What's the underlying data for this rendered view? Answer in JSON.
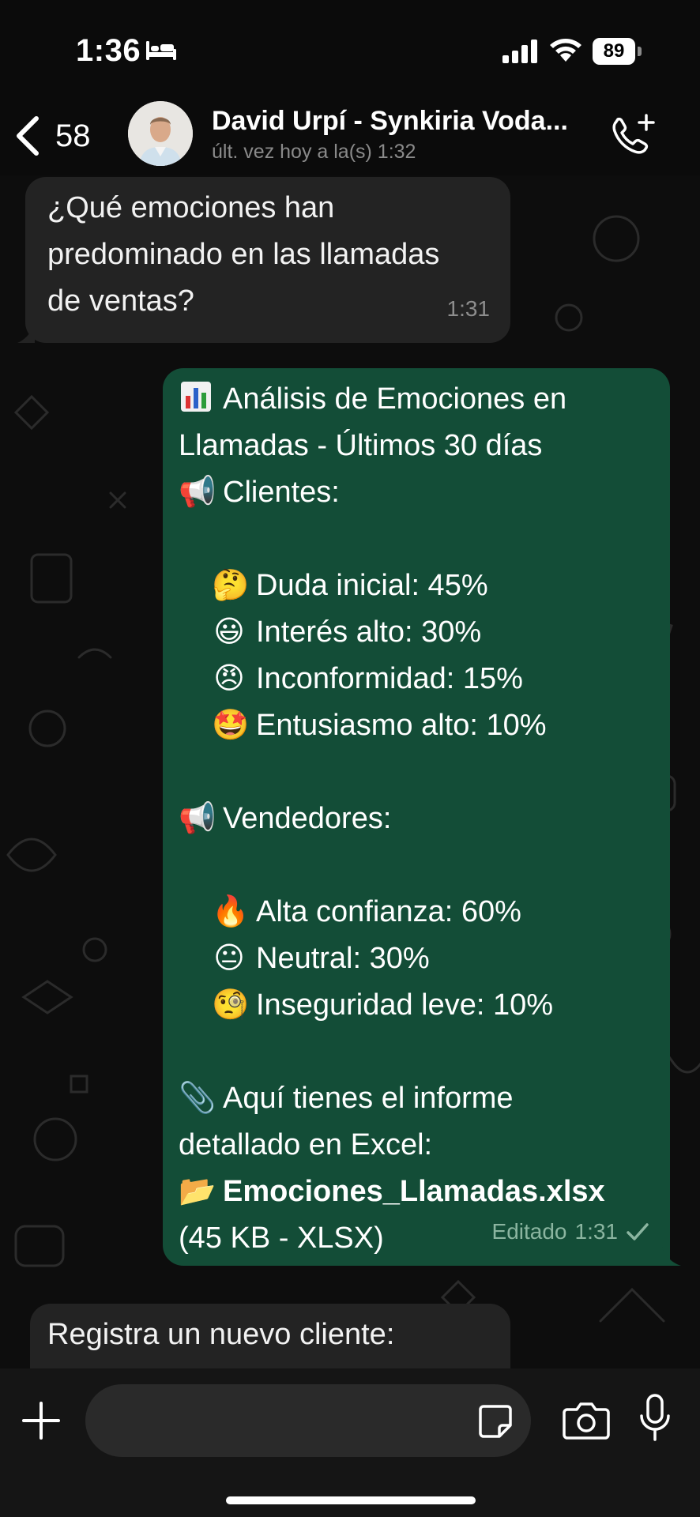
{
  "status_bar": {
    "time": "1:36",
    "battery": "89"
  },
  "header": {
    "back_count": "58",
    "contact_name": "David Urpí - Synkiria Voda...",
    "contact_status": "últ. vez hoy a la(s) 1:32"
  },
  "messages": [
    {
      "direction": "incoming",
      "lines": [
        "¿Qué emociones han",
        "predominado en las llamadas",
        "de ventas?"
      ],
      "time": "1:31"
    },
    {
      "direction": "outgoing",
      "title_lines": [
        "Análisis de Emociones en",
        "Llamadas - Últimos 30 días"
      ],
      "clients_header": "Clientes:",
      "clients": [
        {
          "icon": "thinking-face-icon",
          "emoji": "🤔",
          "text": "Duda inicial: 45%"
        },
        {
          "icon": "smiling-face-icon",
          "emoji": "😃",
          "text": "Interés alto: 30%"
        },
        {
          "icon": "angry-face-icon",
          "emoji": "😠",
          "text": "Inconformidad: 15%"
        },
        {
          "icon": "star-struck-icon",
          "emoji": "🤩",
          "text": "Entusiasmo alto: 10%"
        }
      ],
      "sellers_header": "Vendedores:",
      "sellers": [
        {
          "icon": "fire-icon",
          "emoji": "🔥",
          "text": "Alta confianza: 60%"
        },
        {
          "icon": "neutral-face-icon",
          "emoji": "😐",
          "text": "Neutral: 30%"
        },
        {
          "icon": "monocle-face-icon",
          "emoji": "🧐",
          "text": "Inseguridad leve: 10%"
        }
      ],
      "report_lines": [
        "Aquí tienes el informe",
        "detallado en Excel:"
      ],
      "file_name": "Emociones_Llamadas.xlsx",
      "file_info": "(45 KB - XLSX)",
      "edited_label": "Editado",
      "time": "1:31"
    },
    {
      "direction": "incoming",
      "lines": [
        "Registra un nuevo cliente:"
      ]
    }
  ],
  "composer": {
    "placeholder": ""
  },
  "colors": {
    "outgoing_bubble": "#134d37",
    "incoming_bubble": "#232323",
    "background": "#0b0b0b"
  }
}
